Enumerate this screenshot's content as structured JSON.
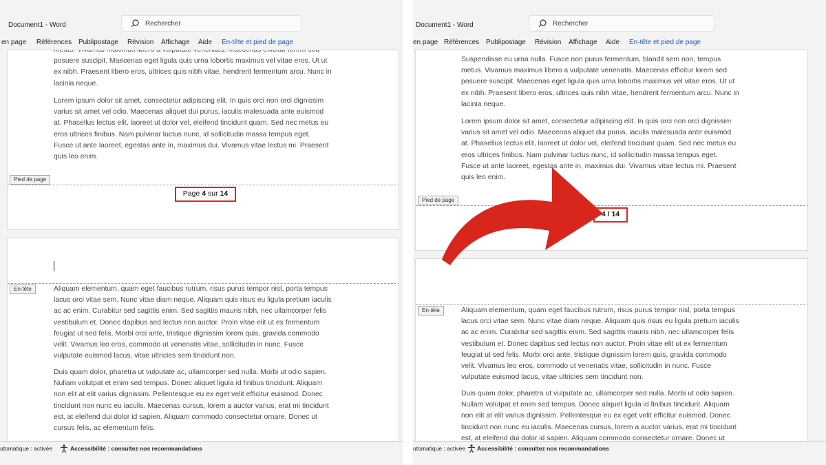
{
  "window": {
    "doc_title": "Document1  -  Word",
    "search_placeholder": "Rechercher"
  },
  "ribbon_left": [
    "en page",
    "Références",
    "Publipostage",
    "Révision",
    "Affichage",
    "Aide",
    "En-tête et pied de page"
  ],
  "ribbon_right": [
    "en page",
    "Références",
    "Publipostage",
    "Révision",
    "Affichage",
    "Aide",
    "En-tête et pied de page"
  ],
  "labels": {
    "footer": "Pied de page",
    "header": "En-tête"
  },
  "before": {
    "page_prefix": "Page ",
    "page_current": "4",
    "page_mid": " sur ",
    "page_total": "14"
  },
  "after": {
    "page_current": "4",
    "page_sep": " / ",
    "page_total": "14"
  },
  "text": {
    "left_top_lines": [
      "metus. Vivamus maximus libero a vulputate venenatis. Maecenas efficitur lorem sed",
      "posuere suscipit. Maecenas eget ligula quis urna lobortis maximus vel vitae eros. Ut ut",
      "ex nibh. Praesent libero eros, ultrices quis nibh vitae, hendrerit fermentum arcu. Nunc in",
      "lacinia neque."
    ],
    "right_top_lines": [
      "Suspendisse eu urna nulla. Fusce non purus fermentum, blandit sem non, tempus",
      "metus. Vivamus maximus libero a vulputate venenatis. Maecenas efficitur lorem sed",
      "posuere suscipit. Maecenas eget ligula quis urna lobortis maximus vel vitae eros. Ut ut",
      "ex nibh. Praesent libero eros, ultrices quis nibh vitae, hendrerit fermentum arcu. Nunc in",
      "lacinia neque."
    ],
    "lorem_para": [
      "Lorem ipsum dolor sit amet, consectetur adipiscing elit. In quis orci non orci dignissim",
      "varius sit amet vel odio. Maecenas aliquet dui purus, iaculis malesuada ante euismod",
      "at. Phasellus lectus elit, laoreet ut dolor vel, eleifend tincidunt quam. Sed nec metus eu",
      "eros ultrices finibus. Nam pulvinar luctus nunc, id sollicitudin massa tempus eget.",
      "Fusce ut ante laoreet, egestas ante in, maximus dui. Vivamus vitae lectus mi. Praesent",
      "quis leo enim."
    ],
    "aliquam_para": [
      "Aliquam elementum, quam eget faucibus rutrum, risus purus tempor nisl, porta tempus",
      "lacus orci vitae sem. Nunc vitae diam neque. Aliquam quis risus eu ligula pretium iaculis",
      "ac ac enim. Curabitur sed sagittis enim. Sed sagittis mauris nibh, nec ullamcorper felis",
      "vestibulum et. Donec dapibus sed lectus non auctor. Proin vitae elit ut ex fermentum",
      "feugiat ut sed felis. Morbi orci ante, tristique dignissim lorem quis, gravida commodo",
      "velit. Vivamus leo eros, commodo ut venenatis vitae, sollicitudin in nunc. Fusce",
      "vulputate euismod lacus, vitae ultricies sem tincidunt non."
    ],
    "duis_para": [
      "Duis quam dolor, pharetra ut vulputate ac, ullamcorper sed nulla. Morbi ut odio sapien.",
      "Nullam volutpat et enim sed tempus. Donec aliquet ligula id finibus tincidunt. Aliquam",
      "non elit at elit varius dignissim. Pellentesque eu ex eget velit efficitur euismod. Donec",
      "tincidunt non nunc eu iaculis. Maecenas cursus, lorem a auctor varius, erat mi tincidunt",
      "est, at eleifend dui dolor id sapien. Aliquam commodo consectetur ornare. Donec ut",
      "cursus felis, ac elementum felis."
    ]
  },
  "status": {
    "autosave": "utomatique : activée",
    "accessibility": "Accessibilité : consultez nos recommandations"
  },
  "colors": {
    "highlight_box": "#e0251d",
    "arrow": "#d9261c",
    "accent": "#1e5bbd",
    "spell_underline": "#e04141"
  }
}
